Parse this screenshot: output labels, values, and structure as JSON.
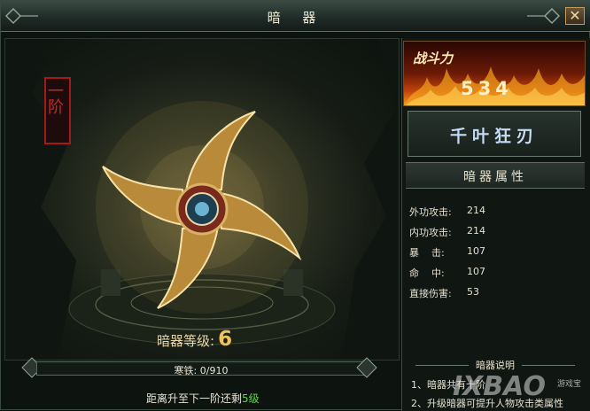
{
  "window": {
    "title": "暗 器",
    "close_label": "✕"
  },
  "weapon": {
    "tier": "一阶",
    "level_label": "暗器等级:",
    "level_value": "6",
    "exp_text": "寒铁: 0/910",
    "exp_fraction": 0.0,
    "remain_prefix": "距离升至下一阶还剩",
    "remain_value": "5级"
  },
  "power": {
    "label": "战斗力",
    "value": "534"
  },
  "name": "千叶狂刃",
  "attributes": {
    "header": "暗器属性",
    "rows": [
      {
        "label": "外功攻击:",
        "value": "214"
      },
      {
        "label": "内功攻击:",
        "value": "214"
      },
      {
        "label": "暴    击:",
        "value": "107"
      },
      {
        "label": "命    中:",
        "value": "107"
      },
      {
        "label": "直接伤害:",
        "value": "53"
      }
    ]
  },
  "description": {
    "header": "暗器说明",
    "lines": [
      "1、暗器共有十阶",
      "2、升级暗器可提升人物攻击类属性"
    ]
  },
  "watermark": {
    "main": "IXBAO",
    "sub": "游戏宝"
  },
  "colors": {
    "level_accent": "#f0c25a",
    "remain_accent": "#5fd24a",
    "seal_red": "#c4282b",
    "name_blue": "#c6dcf4"
  }
}
